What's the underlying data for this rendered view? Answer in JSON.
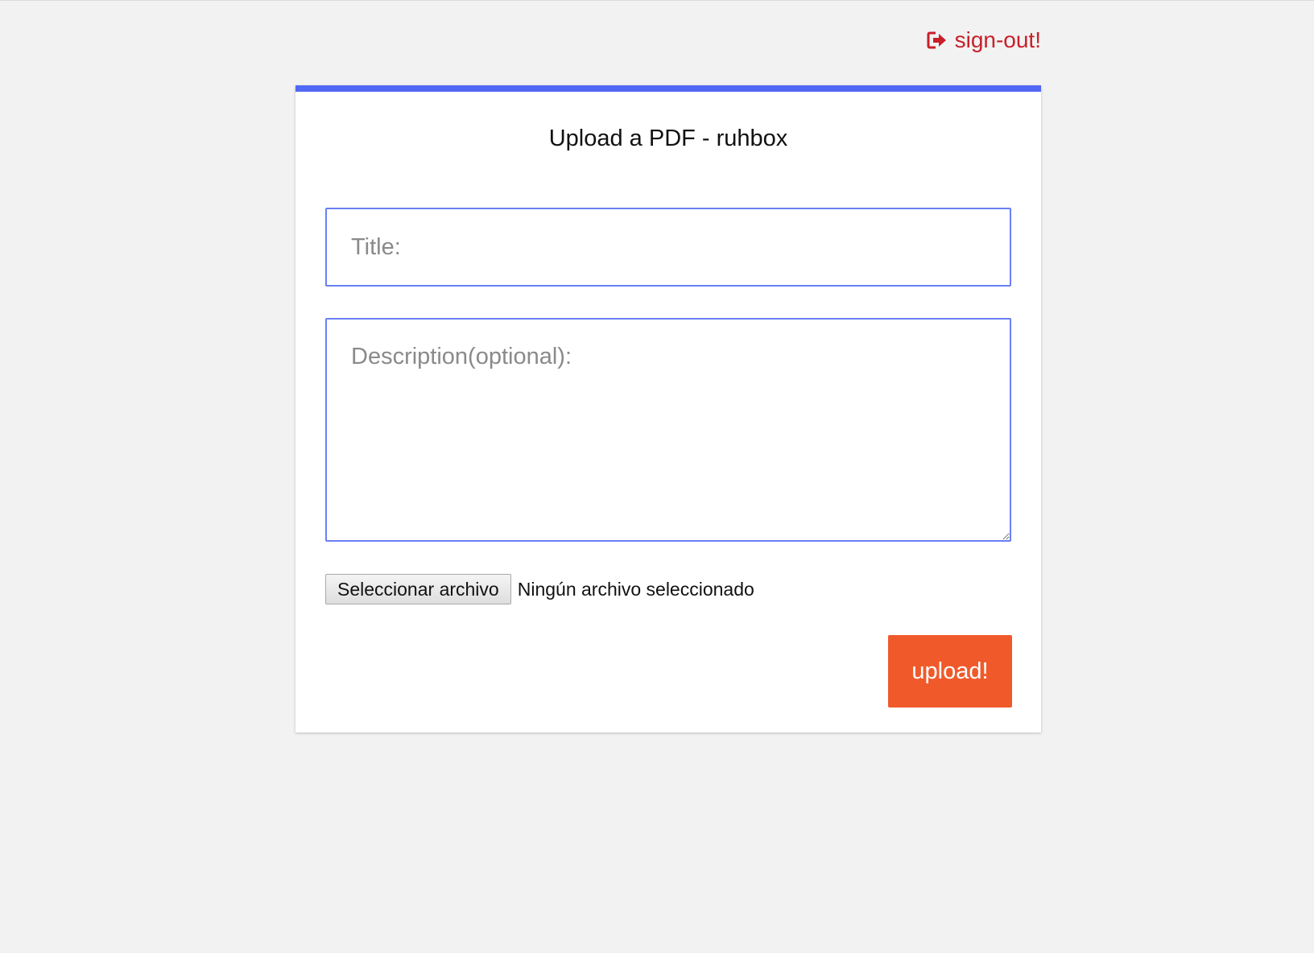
{
  "header": {
    "signout_label": "sign-out!",
    "signout_icon": "sign-out-icon",
    "signout_color": "#c8202a"
  },
  "card": {
    "title": "Upload a PDF - ruhbox",
    "accent_color": "#5168f5"
  },
  "form": {
    "title_placeholder": "Title:",
    "title_value": "",
    "description_placeholder": "Description(optional):",
    "description_value": "",
    "file_button_label": "Seleccionar archivo",
    "file_status": "Ningún archivo seleccionado",
    "submit_label": "upload!",
    "submit_color": "#f05a2b"
  }
}
